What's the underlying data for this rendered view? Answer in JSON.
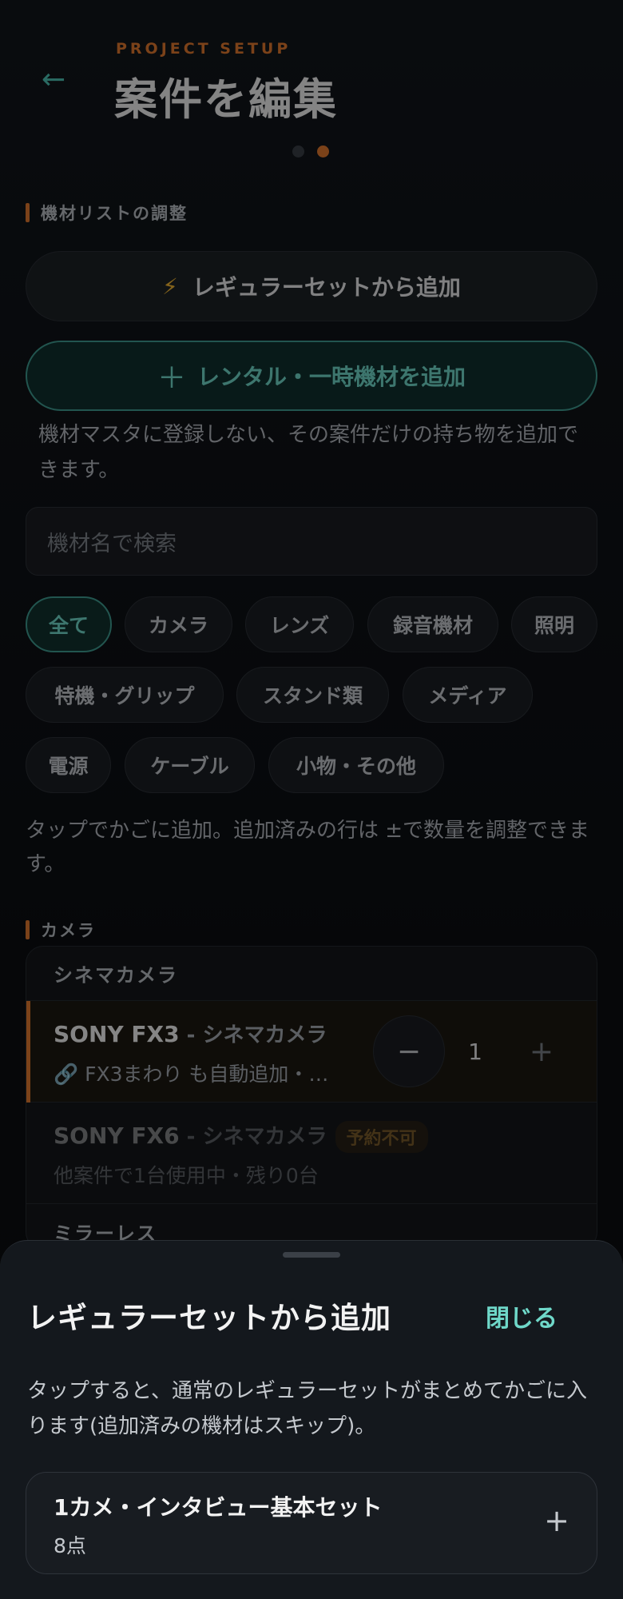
{
  "header": {
    "back_icon": "←",
    "eyebrow": "PROJECT SETUP",
    "title": "案件を編集",
    "page_dots": 2,
    "active_dot": 2
  },
  "equipment_section": {
    "label": "機材リストの調整",
    "regular_set_button": {
      "icon": "⚡",
      "label": "レギュラーセットから追加"
    },
    "rental_button": {
      "icon": "＋",
      "label": "レンタル・一時機材を追加"
    },
    "rental_helper": "機材マスタに登録しない、その案件だけの持ち物を追加できます。",
    "search": {
      "placeholder": "機材名で検索",
      "value": ""
    },
    "filters": [
      {
        "label": "全て",
        "active": true
      },
      {
        "label": "カメラ",
        "active": false
      },
      {
        "label": "レンズ",
        "active": false
      },
      {
        "label": "録音機材",
        "active": false
      },
      {
        "label": "照明",
        "active": false
      },
      {
        "label": "特機・グリップ",
        "active": false
      },
      {
        "label": "スタンド類",
        "active": false
      },
      {
        "label": "メディア",
        "active": false
      },
      {
        "label": "電源",
        "active": false
      },
      {
        "label": "ケーブル",
        "active": false
      },
      {
        "label": "小物・その他",
        "active": false
      }
    ],
    "tap_note": "タップでかごに追加。追加済みの行は ±で数量を調整できます。"
  },
  "camera_list": {
    "label": "カメラ",
    "groups": [
      {
        "name": "シネマカメラ",
        "items": [
          {
            "name": "SONY FX3",
            "category": " - シネマカメラ",
            "sub": "🔗 FX3まわり も自動追加・…",
            "quantity": 1,
            "minus": "−",
            "plus": "+"
          },
          {
            "name": "SONY FX6",
            "category": " - シネマカメラ",
            "badge": "予約不可",
            "sub": "他案件で1台使用中・残り0台"
          }
        ]
      },
      {
        "name": "ミラーレス",
        "items": []
      }
    ]
  },
  "sheet": {
    "title": "レギュラーセットから追加",
    "close_label": "閉じる",
    "description": "タップすると、通常のレギュラーセットがまとめてかごに入ります(追加済みの機材はスキップ)。",
    "sets": [
      {
        "name": "1カメ・インタビュー基本セット",
        "count": "8点",
        "add_icon": "+"
      }
    ]
  },
  "colors": {
    "accent_orange": "#e0782f",
    "accent_teal": "#6fd8c9",
    "background": "#0d1014"
  }
}
